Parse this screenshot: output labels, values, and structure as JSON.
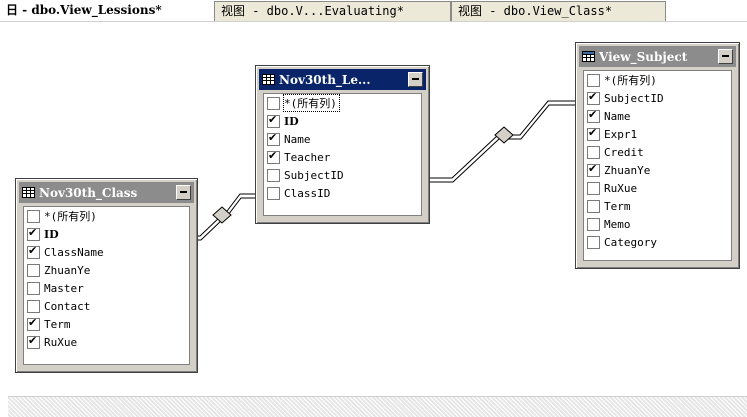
{
  "tabs": [
    {
      "label": "日 - dbo.View_Lessions*",
      "active": true
    },
    {
      "label": "视图 - dbo.V...Evaluating*",
      "active": false
    },
    {
      "label": "视图 - dbo.View_Class*",
      "active": false
    }
  ],
  "tables": {
    "class": {
      "title": "Nov30th_Class",
      "active": false,
      "icon": "grid-table-icon",
      "columns": [
        {
          "label": "*(所有列)",
          "checked": false
        },
        {
          "label": "ID",
          "checked": true,
          "bold": true
        },
        {
          "label": "ClassName",
          "checked": true
        },
        {
          "label": "ZhuanYe",
          "checked": false
        },
        {
          "label": "Master",
          "checked": false
        },
        {
          "label": "Contact",
          "checked": false
        },
        {
          "label": "Term",
          "checked": true
        },
        {
          "label": "RuXue",
          "checked": true
        }
      ]
    },
    "lessons": {
      "title": "Nov30th_Le...",
      "active": true,
      "icon": "grid-table-icon",
      "columns": [
        {
          "label": "*(所有列)",
          "checked": false,
          "focus": true
        },
        {
          "label": "ID",
          "checked": true,
          "bold": true
        },
        {
          "label": "Name",
          "checked": true
        },
        {
          "label": "Teacher",
          "checked": true
        },
        {
          "label": "SubjectID",
          "checked": false
        },
        {
          "label": "ClassID",
          "checked": false
        }
      ]
    },
    "subject": {
      "title": "View_Subject",
      "active": false,
      "icon": "view-table-icon",
      "columns": [
        {
          "label": "*(所有列)",
          "checked": false
        },
        {
          "label": "SubjectID",
          "checked": true
        },
        {
          "label": "Name",
          "checked": true
        },
        {
          "label": "Expr1",
          "checked": true
        },
        {
          "label": "Credit",
          "checked": false
        },
        {
          "label": "ZhuanYe",
          "checked": true
        },
        {
          "label": "RuXue",
          "checked": false
        },
        {
          "label": "Term",
          "checked": false
        },
        {
          "label": "Memo",
          "checked": false
        },
        {
          "label": "Category",
          "checked": false
        }
      ]
    }
  },
  "colors": {
    "active_title": "#0a246a",
    "inactive_title": "#8c8c8c",
    "panel": "#d4d0c8"
  }
}
